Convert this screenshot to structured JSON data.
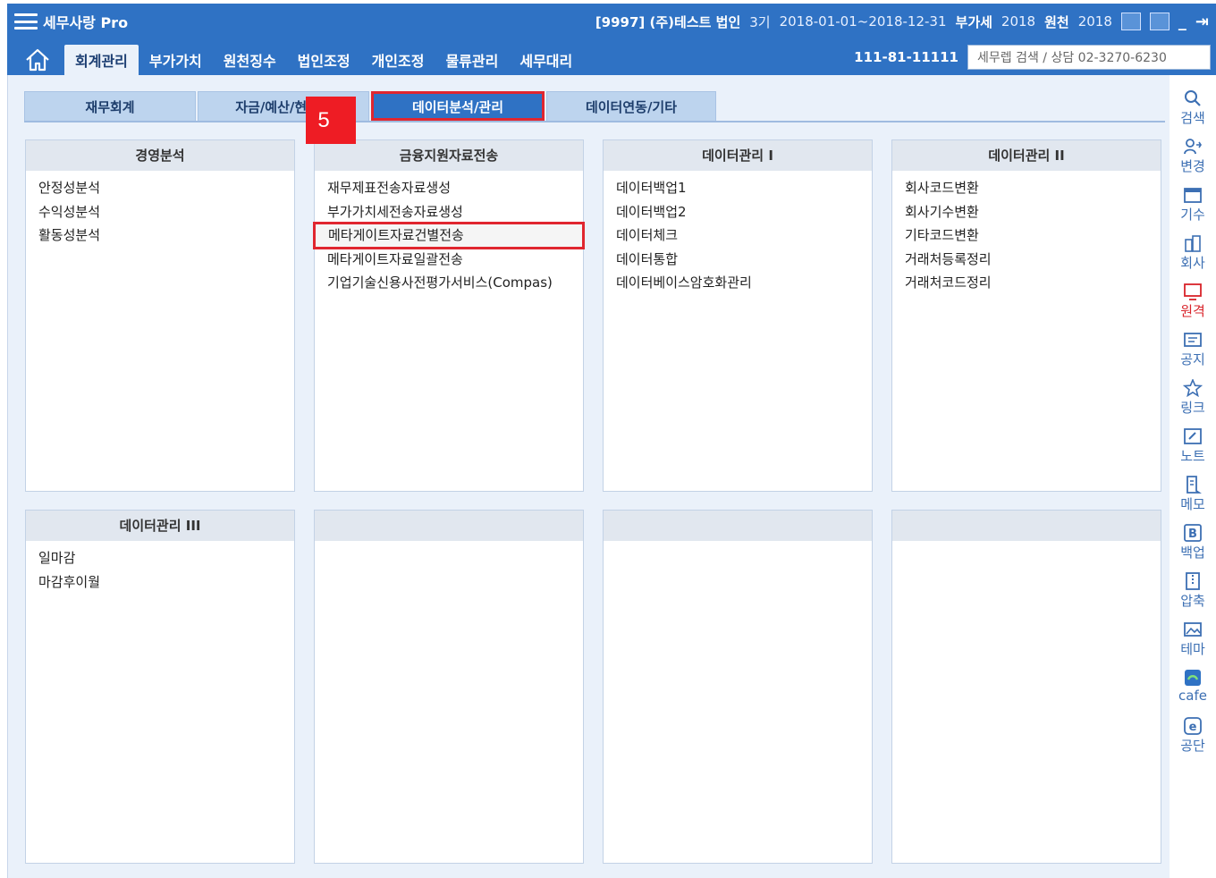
{
  "titlebar": {
    "app_name": "세무사랑 Pro",
    "company": "[9997] (주)테스트 법인",
    "period_label": "3기",
    "period": "2018-01-01~2018-12-31",
    "vat_label": "부가세",
    "vat_year": "2018",
    "withholding_label": "원천",
    "withholding_year": "2018"
  },
  "menubar": {
    "tabs": [
      "회계관리",
      "부가가치",
      "원천징수",
      "법인조정",
      "개인조정",
      "물류관리",
      "세무대리"
    ],
    "active_index": 0,
    "business_number": "111-81-11111",
    "search_value": "세무렙 검색 / 상담 02-3270-6230"
  },
  "subtabs": {
    "items": [
      "재무회계",
      "자금/예산/현장등",
      "데이터분석/관리",
      "데이터연동/기타"
    ],
    "active_index": 2
  },
  "panels": [
    {
      "title": "경영분석",
      "items": [
        "안정성분석",
        "수익성분석",
        "활동성분석"
      ]
    },
    {
      "title": "금융지원자료전송",
      "items": [
        "재무제표전송자료생성",
        "부가가치세전송자료생성",
        "메타게이트자료건별전송",
        "메타게이트자료일괄전송",
        "기업기술신용사전평가서비스(Compas)"
      ],
      "highlight_index": 2
    },
    {
      "title": "데이터관리 I",
      "items": [
        "데이터백업1",
        "데이터백업2",
        "데이터체크",
        "데이터통합",
        "데이터베이스암호화관리"
      ]
    },
    {
      "title": "데이터관리 II",
      "items": [
        "회사코드변환",
        "회사기수변환",
        "기타코드변환",
        "거래처등록정리",
        "거래처코드정리"
      ]
    },
    {
      "title": "데이터관리 III",
      "items": [
        "일마감",
        "마감후이월"
      ]
    },
    {
      "title": "",
      "items": []
    },
    {
      "title": "",
      "items": []
    },
    {
      "title": "",
      "items": []
    }
  ],
  "step_badge": "5",
  "sidebar": [
    "검색",
    "변경",
    "기수",
    "회사",
    "원격",
    "공지",
    "링크",
    "노트",
    "메모",
    "백업",
    "압축",
    "테마",
    "cafe",
    "공단"
  ],
  "colors": {
    "header_blue": "#2f72c4",
    "content_bg": "#eaf1fa",
    "highlight_red": "#e0262f",
    "badge_red": "#ee1c24"
  }
}
